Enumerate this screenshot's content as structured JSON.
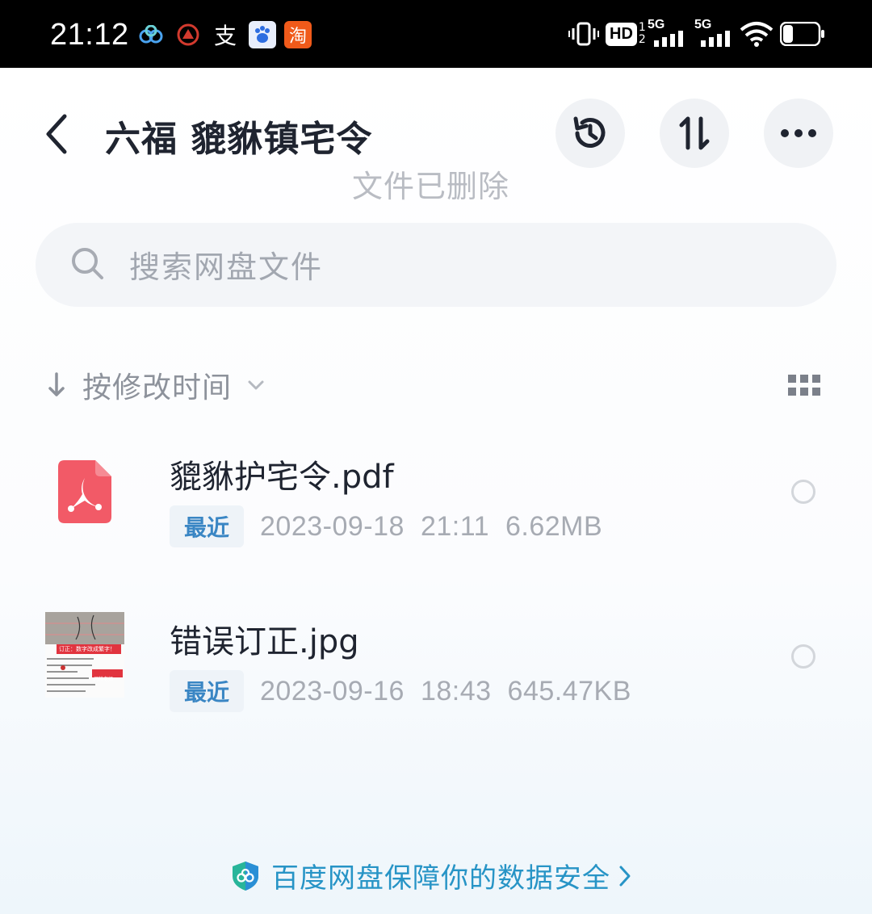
{
  "status": {
    "time": "21:12",
    "notifications": [
      {
        "icon": "baidu-netdisk-icon"
      },
      {
        "icon": "bank-icon"
      },
      {
        "icon": "alipay-icon"
      },
      {
        "icon": "baidu-icon"
      },
      {
        "icon": "taobao-icon"
      }
    ],
    "hd_label": "HD",
    "sim1_label": "5G",
    "sim2_label": "5G"
  },
  "header": {
    "title": "六福 貔貅镇宅令",
    "toast": "文件已删除"
  },
  "search": {
    "placeholder": "搜索网盘文件"
  },
  "sort": {
    "label": "按修改时间"
  },
  "files": [
    {
      "name": "貔貅护宅令.pdf",
      "badge": "最近",
      "date": "2023-09-18",
      "time": "21:11",
      "size": "6.62MB",
      "icon": "pdf-file-icon",
      "selected": false
    },
    {
      "name": "错误订正.jpg",
      "badge": "最近",
      "date": "2023-09-16",
      "time": "18:43",
      "size": "645.47KB",
      "icon": "image-thumbnail",
      "selected": false,
      "thumbnail": {
        "banner": "订正：数字改成繁字！",
        "stamp": "闪神老师"
      }
    }
  ],
  "footer": {
    "text": "百度网盘保障你的数据安全"
  },
  "colors": {
    "accent": "#2794c6",
    "pdf": "#f25a67",
    "badge_text": "#3a86c4"
  }
}
